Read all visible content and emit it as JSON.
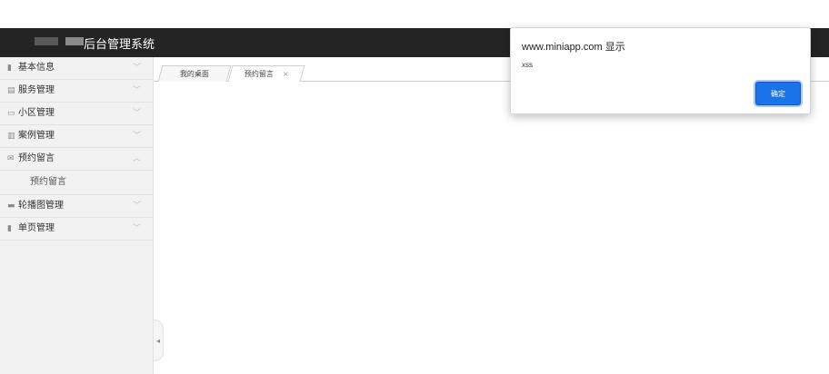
{
  "header": {
    "title": "后台管理系统"
  },
  "sidebar": {
    "items": [
      {
        "label": "基本信息",
        "icon": "document-icon",
        "glyph": "▮",
        "chev": "﹀"
      },
      {
        "label": "服务管理",
        "icon": "list-icon",
        "glyph": "▤",
        "chev": "﹀"
      },
      {
        "label": "小区管理",
        "icon": "window-icon",
        "glyph": "▭",
        "chev": "﹀"
      },
      {
        "label": "案例管理",
        "icon": "calendar-icon",
        "glyph": "▥",
        "chev": "﹀"
      },
      {
        "label": "预约留言",
        "icon": "mail-icon",
        "glyph": "✉",
        "chev": "︿"
      },
      {
        "label": "轮播图管理",
        "icon": "image-icon",
        "glyph": "▬",
        "chev": "﹀"
      },
      {
        "label": "单页管理",
        "icon": "page-icon",
        "glyph": "▮",
        "chev": "﹀"
      }
    ],
    "sub_item": "预约留言",
    "collapse_glyph": "◂"
  },
  "tabs": [
    {
      "label": "我的桌面"
    },
    {
      "label": "预约留言",
      "close": "×"
    }
  ],
  "dialog": {
    "title": "www.miniapp.com 显示",
    "message": "xss",
    "ok_label": "确定"
  }
}
